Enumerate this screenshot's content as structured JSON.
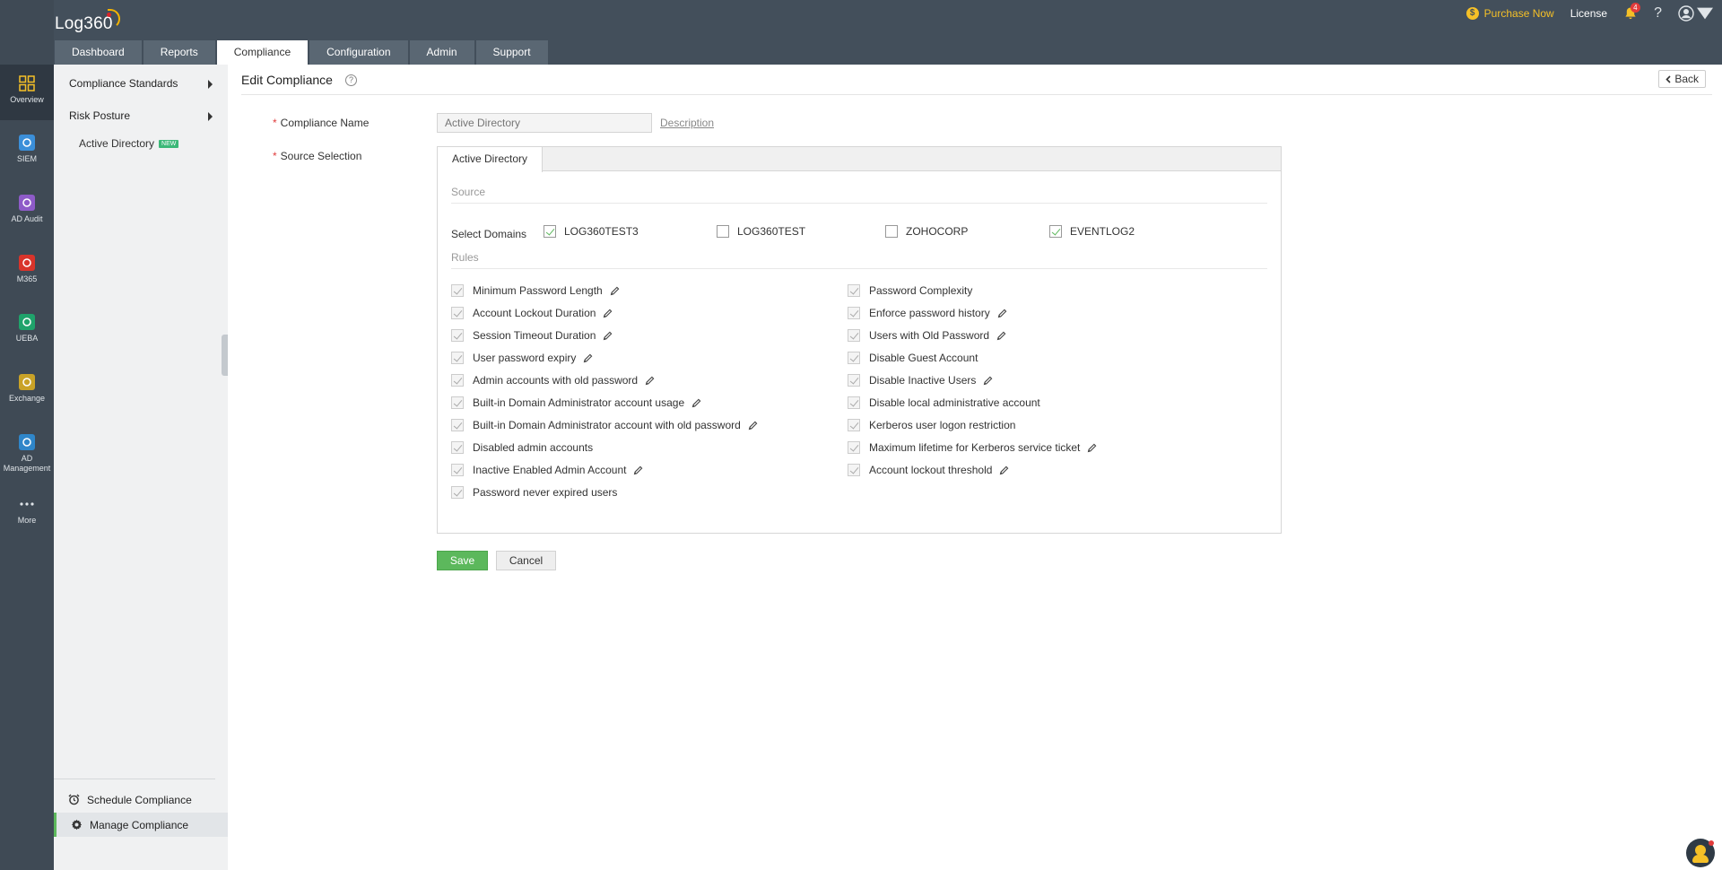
{
  "app": {
    "title": "Log360"
  },
  "top_tabs": [
    "Dashboard",
    "Reports",
    "Compliance",
    "Configuration",
    "Admin",
    "Support"
  ],
  "active_tab": "Compliance",
  "header_right": {
    "purchase_label": "Purchase Now",
    "license_label": "License",
    "notification_count": "4",
    "help_label": "?"
  },
  "rail": [
    {
      "label": "Overview",
      "icon": "overview-icon",
      "color": "#f5c027"
    },
    {
      "label": "SIEM",
      "icon": "siem-icon",
      "color": "#3b8fd9"
    },
    {
      "label": "AD Audit",
      "icon": "ad-audit-icon",
      "color": "#8e5bc8"
    },
    {
      "label": "M365",
      "icon": "m365-icon",
      "color": "#d9342b"
    },
    {
      "label": "UEBA",
      "icon": "ueba-icon",
      "color": "#1fa36b"
    },
    {
      "label": "Exchange",
      "icon": "exchange-icon",
      "color": "#c9a227"
    },
    {
      "label": "AD Management",
      "icon": "ad-management-icon",
      "color": "#2f86c9"
    },
    {
      "label": "More",
      "icon": "more-icon",
      "color": "#dfe4e8"
    }
  ],
  "sidebar": {
    "compliance_standards": "Compliance Standards",
    "risk_posture": "Risk Posture",
    "active_directory": "Active Directory",
    "new_badge": "NEW",
    "schedule_compliance": "Schedule Compliance",
    "manage_compliance": "Manage Compliance"
  },
  "page": {
    "title": "Edit Compliance",
    "back_label": "Back",
    "compliance_name_label": "Compliance Name",
    "compliance_name_placeholder": "Active Directory",
    "description_link": "Description",
    "source_selection_label": "Source Selection",
    "source_tab": "Active Directory",
    "source_heading": "Source",
    "select_domains_label": "Select Domains",
    "rules_heading": "Rules",
    "save_label": "Save",
    "cancel_label": "Cancel"
  },
  "domains": [
    {
      "name": "LOG360TEST3",
      "checked": true
    },
    {
      "name": "LOG360TEST",
      "checked": false
    },
    {
      "name": "ZOHOCORP",
      "checked": false
    },
    {
      "name": "EVENTLOG2",
      "checked": true
    }
  ],
  "rules_left": [
    {
      "name": "Minimum Password Length",
      "editable": true
    },
    {
      "name": "Account Lockout Duration",
      "editable": true
    },
    {
      "name": "Session Timeout Duration",
      "editable": true
    },
    {
      "name": "User password expiry",
      "editable": true
    },
    {
      "name": "Admin accounts with old password",
      "editable": true
    },
    {
      "name": "Built-in Domain Administrator account usage",
      "editable": true
    },
    {
      "name": "Built-in Domain Administrator account with old password",
      "editable": true
    },
    {
      "name": "Disabled admin accounts",
      "editable": false
    },
    {
      "name": "Inactive Enabled Admin Account",
      "editable": true
    },
    {
      "name": "Password never expired users",
      "editable": false
    }
  ],
  "rules_right": [
    {
      "name": "Password Complexity",
      "editable": false
    },
    {
      "name": "Enforce password history",
      "editable": true
    },
    {
      "name": "Users with Old Password",
      "editable": true
    },
    {
      "name": "Disable Guest Account",
      "editable": false
    },
    {
      "name": "Disable Inactive Users",
      "editable": true
    },
    {
      "name": "Disable local administrative account",
      "editable": false
    },
    {
      "name": "Kerberos user logon restriction",
      "editable": false
    },
    {
      "name": "Maximum lifetime for Kerberos service ticket",
      "editable": true
    },
    {
      "name": "Account lockout threshold",
      "editable": true
    }
  ]
}
